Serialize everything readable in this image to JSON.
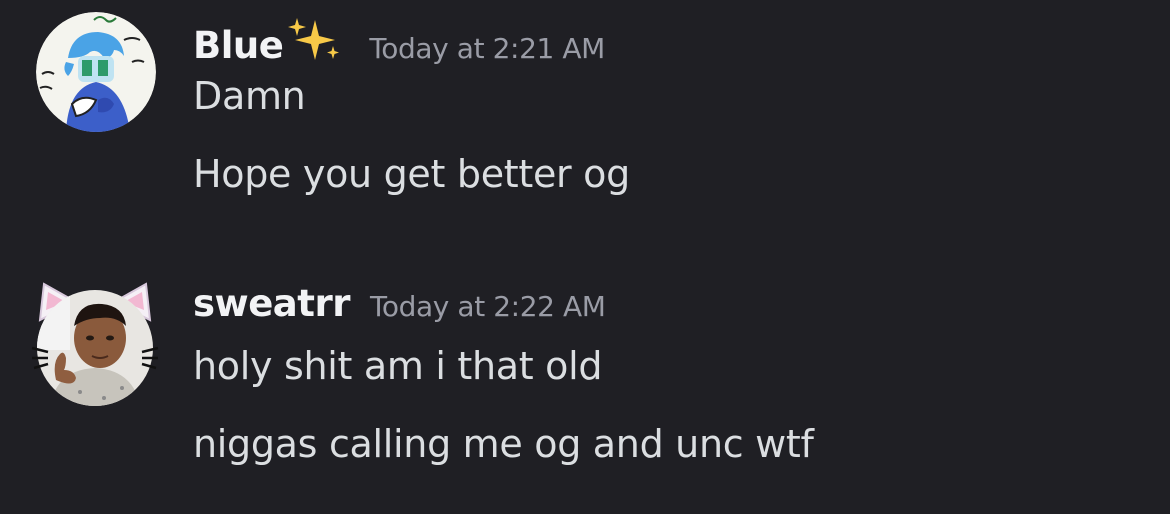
{
  "messages": [
    {
      "username": "Blue",
      "badge_icon": "sparkles-emoji",
      "timestamp": "Today at 2:21 AM",
      "avatar_icon": "drawn-character-avatar",
      "lines": [
        "Damn",
        "Hope you get better og"
      ]
    },
    {
      "username": "sweatrr",
      "timestamp": "Today at 2:22 AM",
      "avatar_icon": "photo-avatar-with-cat-ears",
      "lines": [
        "holy shit am i that old",
        "niggas calling me og and unc wtf"
      ]
    }
  ],
  "colors": {
    "background": "#1f1f24",
    "username": "#f2f3f5",
    "timestamp": "#9a9ca6",
    "message_text": "#dbdee1",
    "sparkle": "#f7c948"
  }
}
